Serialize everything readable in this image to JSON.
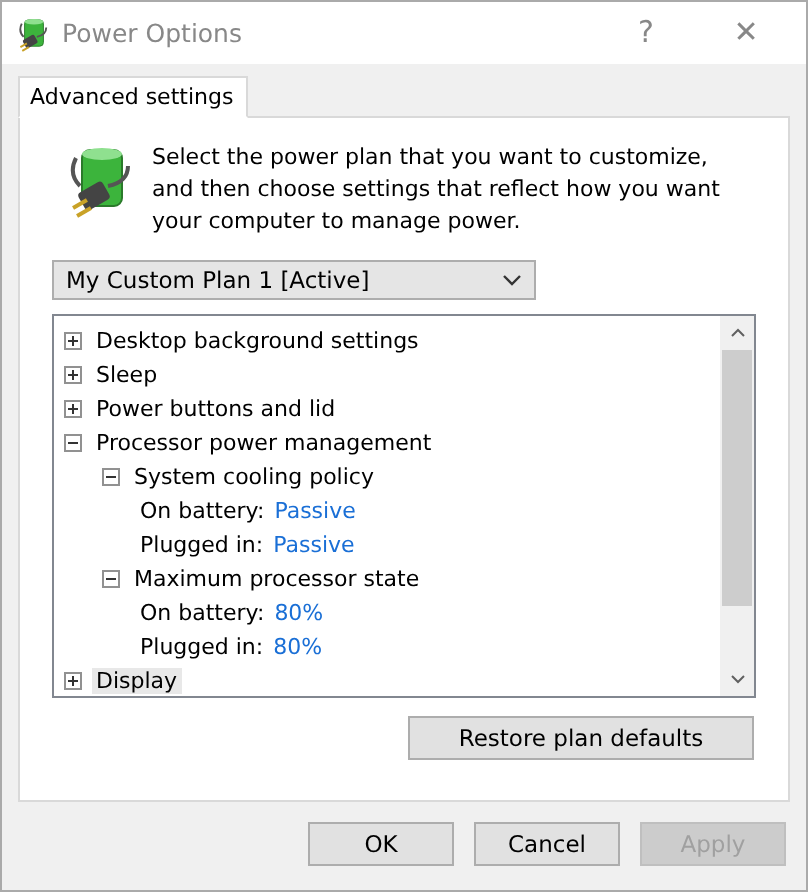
{
  "window": {
    "title": "Power Options",
    "help_button": "?",
    "close_button": "✕"
  },
  "tabs": [
    {
      "label": "Advanced settings",
      "selected": true
    }
  ],
  "intro": "Select the power plan that you want to customize, and then choose settings that reflect how you want your computer to manage power.",
  "plan_dropdown": {
    "value": "My Custom Plan 1 [Active]"
  },
  "tree": [
    {
      "kind": "group",
      "label": "Desktop background settings",
      "expanded": false,
      "selected": false
    },
    {
      "kind": "group",
      "label": "Sleep",
      "expanded": false,
      "selected": false
    },
    {
      "kind": "group",
      "label": "Power buttons and lid",
      "expanded": false,
      "selected": false
    },
    {
      "kind": "group",
      "label": "Processor power management",
      "expanded": true,
      "selected": false,
      "children": [
        {
          "kind": "group",
          "label": "System cooling policy",
          "expanded": true,
          "selected": false,
          "children": [
            {
              "kind": "setting",
              "label": "On battery:",
              "value": "Passive",
              "selected": false
            },
            {
              "kind": "setting",
              "label": "Plugged in:",
              "value": "Passive",
              "selected": false
            }
          ]
        },
        {
          "kind": "group",
          "label": "Maximum processor state",
          "expanded": true,
          "selected": false,
          "children": [
            {
              "kind": "setting",
              "label": "On battery:",
              "value": "80%",
              "selected": false
            },
            {
              "kind": "setting",
              "label": "Plugged in:",
              "value": "80%",
              "selected": false
            }
          ]
        }
      ]
    },
    {
      "kind": "group",
      "label": "Display",
      "expanded": false,
      "selected": true
    }
  ],
  "restore_button": "Restore plan defaults",
  "buttons": [
    {
      "label": "OK",
      "disabled": false
    },
    {
      "label": "Cancel",
      "disabled": false
    },
    {
      "label": "Apply",
      "disabled": true
    }
  ]
}
